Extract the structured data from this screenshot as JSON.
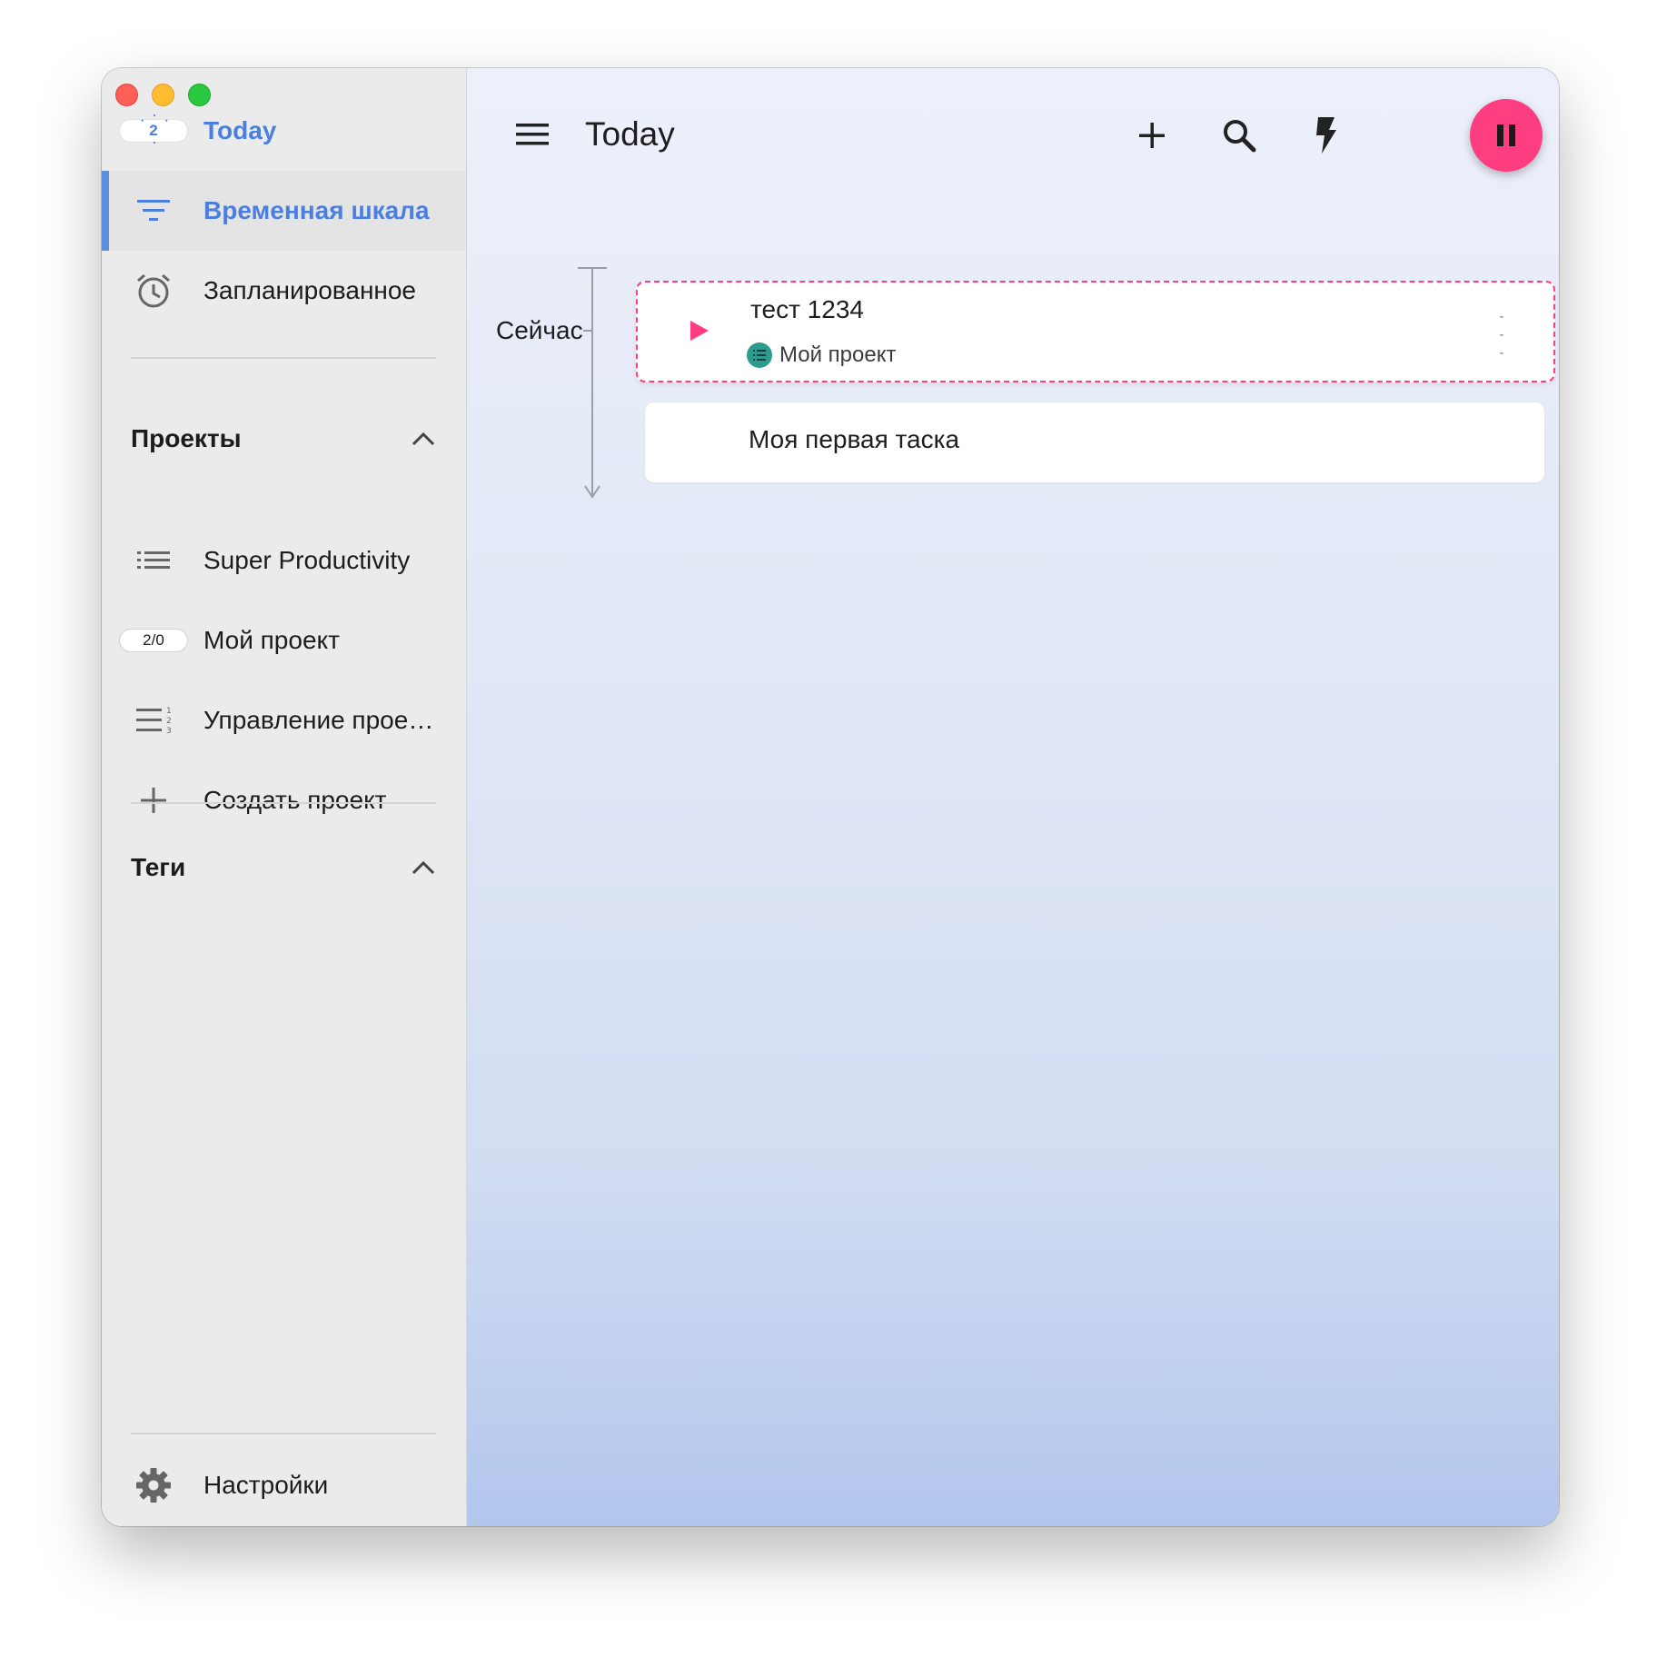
{
  "window": {
    "controls": [
      "close",
      "minimize",
      "maximize"
    ]
  },
  "sidebar": {
    "today": {
      "label": "Today",
      "badge": "2",
      "icon": "calendar-today-icon"
    },
    "timeline": {
      "label": "Временная шкала",
      "icon": "filter-list-icon"
    },
    "scheduled": {
      "label": "Запланированное",
      "icon": "alarm-clock-icon"
    },
    "projects_header": "Проекты",
    "projects": [
      {
        "label": "Super Productivity",
        "icon": "list-icon"
      },
      {
        "label": "Мой проект",
        "badge": "2/0"
      },
      {
        "label": "Управление прое…",
        "icon": "numbered-list-icon"
      },
      {
        "label": "Создать проект",
        "icon": "plus-icon"
      }
    ],
    "tags_header": "Теги",
    "settings": {
      "label": "Настройки",
      "icon": "gear-icon"
    }
  },
  "header": {
    "title": "Today",
    "actions": [
      "add-icon",
      "search-icon",
      "bolt-icon",
      "pause-icon",
      "chat-icon"
    ]
  },
  "timeline": {
    "now_label": "Сейчас",
    "tasks": [
      {
        "title": "тест 1234",
        "project": "Мой проект",
        "current": true
      },
      {
        "title": "Моя первая таска"
      }
    ]
  },
  "colors": {
    "accent": "#4a7fe0",
    "pink": "#ff3d81",
    "project_teal": "#2a9d8f"
  }
}
